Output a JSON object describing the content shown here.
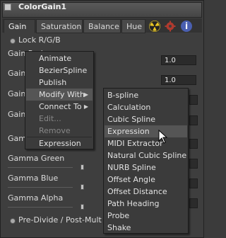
{
  "window": {
    "title": "ColorGain1"
  },
  "tabs": [
    {
      "label": "Gain",
      "active": true
    },
    {
      "label": "Saturation",
      "active": false
    },
    {
      "label": "Balance",
      "active": false
    },
    {
      "label": "Hue",
      "active": false
    }
  ],
  "tab_icons": [
    "radiation-icon",
    "gear-icon",
    "info-icon"
  ],
  "controls": {
    "lock_rgb": "Lock R/G/B",
    "gain_red": "Gain Red",
    "gain_g_partial": "Gain",
    "gain_b_partial": "Gain",
    "gain_a_partial": "Gain",
    "gamma_partial": "Gamm",
    "gamma_green": "Gamma Green",
    "gamma_blue": "Gamma Blue",
    "gamma_alpha": "Gamma Alpha",
    "field_1": "1.0",
    "field_2": "1.0",
    "predivide": "Pre-Divide / Post-Mult"
  },
  "context_menu": {
    "items": [
      {
        "label": "Animate",
        "disabled": false,
        "submenu": false
      },
      {
        "label": "BezierSpline",
        "disabled": false,
        "submenu": false
      },
      {
        "label": "Publish",
        "disabled": false,
        "submenu": false
      },
      {
        "label": "Modify With",
        "disabled": false,
        "submenu": true,
        "highlighted": true
      },
      {
        "label": "Connect To",
        "disabled": false,
        "submenu": true
      },
      {
        "label": "Edit...",
        "disabled": true,
        "submenu": false
      },
      {
        "label": "Remove",
        "disabled": true,
        "submenu": false
      },
      {
        "label": "Expression",
        "disabled": false,
        "submenu": false
      }
    ]
  },
  "submenu": {
    "items": [
      {
        "label": "B-spline"
      },
      {
        "label": "Calculation"
      },
      {
        "label": "Cubic Spline"
      },
      {
        "label": "Expression",
        "highlighted": true
      },
      {
        "label": "MIDI Extractor"
      },
      {
        "label": "Natural Cubic Spline"
      },
      {
        "label": "NURB Spline"
      },
      {
        "label": "Offset Angle"
      },
      {
        "label": "Offset Distance"
      },
      {
        "label": "Path Heading"
      },
      {
        "label": "Probe"
      },
      {
        "label": "Shake"
      }
    ]
  },
  "colors": {
    "panel": "#3e3e3e",
    "menu": "#3b3b3b",
    "highlight": "#555555",
    "text": "#e2e2e2"
  }
}
